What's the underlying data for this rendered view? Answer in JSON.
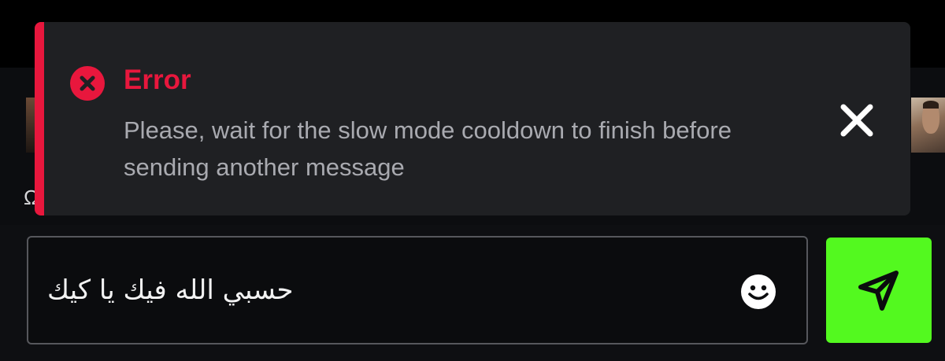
{
  "toast": {
    "type": "error",
    "title": "Error",
    "message": "Please, wait for the slow mode cooldown to finish before sending another message",
    "icon": "error-circle-icon",
    "close_icon": "close-icon",
    "accent_color": "#e8173d",
    "background_color": "#1f2023"
  },
  "background": {
    "partial_text": "Ω"
  },
  "chat": {
    "input_value": "حسبي الله فيك يا كيك",
    "emoji_icon": "smiley-icon",
    "send_icon": "send-arrow-icon",
    "send_color": "#53f91f"
  }
}
